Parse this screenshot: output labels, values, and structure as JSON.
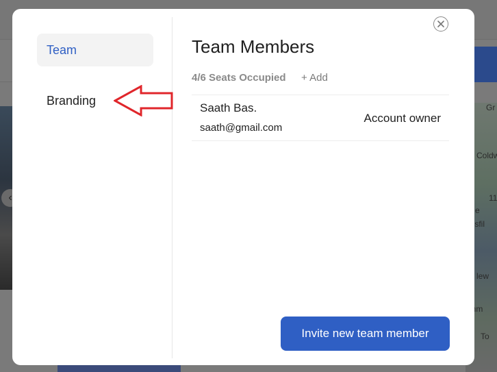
{
  "modal": {
    "sidebar": {
      "items": [
        {
          "label": "Team",
          "active": true
        },
        {
          "label": "Branding",
          "active": false
        }
      ]
    },
    "title": "Team Members",
    "seats": "4/6 Seats Occupied",
    "add_label": "+ Add",
    "members": [
      {
        "name": "Saath Bas.",
        "email": "saath@gmail.com",
        "role": "Account owner"
      }
    ],
    "invite_label": "Invite new team member",
    "close_icon": "close-icon"
  },
  "annotation": {
    "type": "arrow",
    "color": "#e0262b",
    "points_to": "Branding"
  },
  "background": {
    "map_labels": [
      "Gr",
      "Coldw",
      "11",
      "e",
      "nisfil",
      "lew",
      "ichm",
      "To"
    ]
  },
  "colors": {
    "accent": "#2f5fc4",
    "annotation": "#e0262b"
  }
}
